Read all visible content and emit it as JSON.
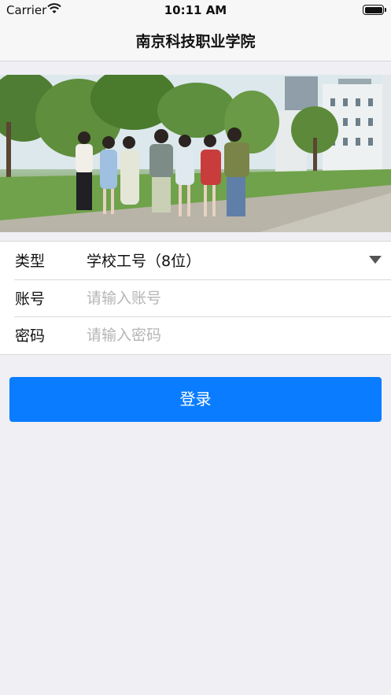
{
  "status_bar": {
    "carrier": "Carrier",
    "time": "10:11 AM",
    "wifi_icon": "wifi-icon",
    "battery_icon": "battery-icon"
  },
  "nav": {
    "title": "南京科技职业学院"
  },
  "banner": {
    "image": "campus-students-photo"
  },
  "form": {
    "type": {
      "label": "类型",
      "value": "学校工号（8位）",
      "icon": "caret-down-icon"
    },
    "account": {
      "label": "账号",
      "placeholder": "请输入账号",
      "value": ""
    },
    "password": {
      "label": "密码",
      "placeholder": "请输入密码",
      "value": ""
    }
  },
  "actions": {
    "login_label": "登录"
  },
  "colors": {
    "accent": "#0a7cff",
    "background": "#efeff4",
    "nav_background": "#f7f7f7"
  }
}
